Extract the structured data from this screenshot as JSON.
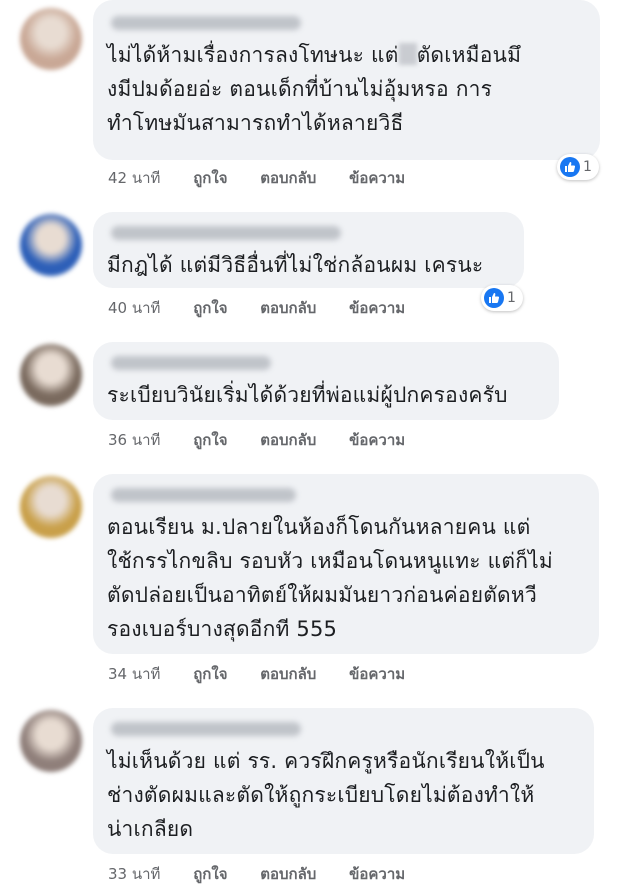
{
  "comments": [
    {
      "lines": [
        "ไม่ได้ห้ามเรื่องการลงโทษนะ แต่",
        "ตัดเหมือนมึ",
        "งมีปมด้อยอ่ะ ตอนเด็กที่บ้านไม่อุ้มหรอ การ",
        "ทำโทษมันสามารถทำได้หลายวิธี"
      ],
      "time": "42 นาที",
      "like": "ถูกใจ",
      "reply": "ตอบกลับ",
      "message": "ข้อความ",
      "reactions": "1",
      "avatar_color": "#c9a896"
    },
    {
      "lines": [
        "มีกฎได้ แต่มีวิธีอื่นที่ไม่ใช่กล้อนผม เครนะ"
      ],
      "time": "40 นาที",
      "like": "ถูกใจ",
      "reply": "ตอบกลับ",
      "message": "ข้อความ",
      "reactions": "1",
      "avatar_color": "#2d5fb8"
    },
    {
      "lines": [
        "ระเบียบวินัยเริ่มได้ด้วยที่พ่อแม่ผู้ปกครองครับ"
      ],
      "time": "36 นาที",
      "like": "ถูกใจ",
      "reply": "ตอบกลับ",
      "message": "ข้อความ",
      "avatar_color": "#7a6a5e"
    },
    {
      "lines": [
        "ตอนเรียน ม.ปลายในห้องก็โดนกันหลายคน แต่",
        "ใช้กรรไกขลิบ รอบหัว เหมือนโดนหนูแทะ แต่ก็ไม่",
        "ตัดปล่อยเป็นอาทิตย์ให้ผมมันยาวก่อนค่อยตัดหวี",
        "รองเบอร์บางสุดอีกที  555"
      ],
      "time": "34 นาที",
      "like": "ถูกใจ",
      "reply": "ตอบกลับ",
      "message": "ข้อความ",
      "avatar_color": "#c9a04a"
    },
    {
      "lines": [
        "ไม่เห็นด้วย แต่ รร. ควรฝึกครูหรือนักเรียนให้เป็น",
        "ช่างตัดผมและตัดให้ถูกระเบียบโดยไม่ต้องทำให้",
        "น่าเกลียด"
      ],
      "time": "33 นาที",
      "like": "ถูกใจ",
      "reply": "ตอบกลับ",
      "message": "ข้อความ",
      "avatar_color": "#8f7f7a"
    }
  ]
}
